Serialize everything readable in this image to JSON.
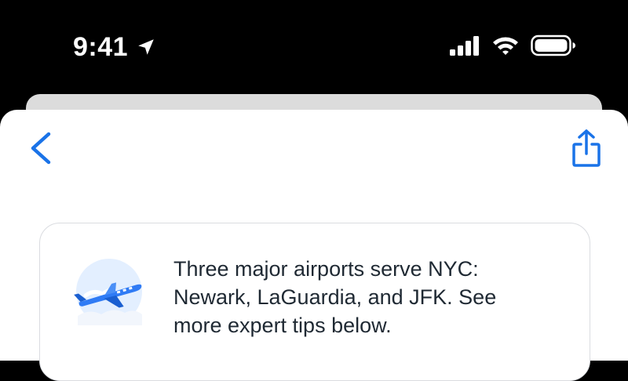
{
  "status_bar": {
    "time": "9:41",
    "icons": [
      "location-arrow-icon",
      "cellular-signal-icon",
      "wifi-icon",
      "battery-icon"
    ]
  },
  "colors": {
    "accent": "#1a73e8",
    "text": "#1f2933",
    "card_border": "#dadce0",
    "status_bar_bg": "#000000",
    "back_sheet": "#dcdcdc"
  },
  "header": {
    "back_icon": "chevron-left-icon",
    "share_icon": "share-icon"
  },
  "tip_card": {
    "illustration": "airplane-illustration-icon",
    "lines": [
      "Three major airports serve NYC:",
      "Newark, LaGuardia, and JFK. See",
      "more expert tips below."
    ]
  }
}
